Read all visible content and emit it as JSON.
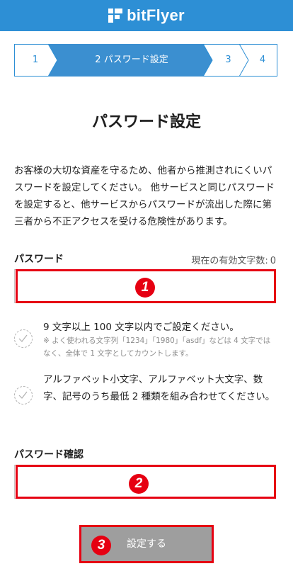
{
  "header": {
    "brand": "bitFlyer",
    "logo_icon": "bitflyer-logo-icon",
    "color": "#2d8fd5"
  },
  "stepper": {
    "steps": [
      {
        "label": "1",
        "active": false
      },
      {
        "label": "2 パスワード設定",
        "active": true
      },
      {
        "label": "3",
        "active": false
      },
      {
        "label": "4",
        "active": false
      }
    ]
  },
  "page": {
    "title": "パスワード設定",
    "description": "お客様の大切な資産を守るため、他者から推測されにくいパスワードを設定してください。 他サービスと同じパスワードを設定すると、他サービスからパスワードが流出した際に第三者から不正アクセスを受ける危険性があります。"
  },
  "password_field": {
    "label": "パスワード",
    "count_prefix": "現在の有効文字数:",
    "count_value": "0",
    "value": ""
  },
  "rules": [
    {
      "text": "9 文字以上 100 文字以内でご設定ください。",
      "note": "※ よく使われる文字列「1234」「1980」「asdf」などは 4 文字ではなく、全体で 1 文字としてカウントします。"
    },
    {
      "text": "アルファベット小文字、アルファベット大文字、数字、記号のうち最低 2 種類を組み合わせてください。"
    }
  ],
  "confirm_field": {
    "label": "パスワード確認",
    "value": ""
  },
  "submit": {
    "label": "設定する"
  },
  "annotations": {
    "m1": "1",
    "m2": "2",
    "m3": "3",
    "color": "#e60012"
  }
}
